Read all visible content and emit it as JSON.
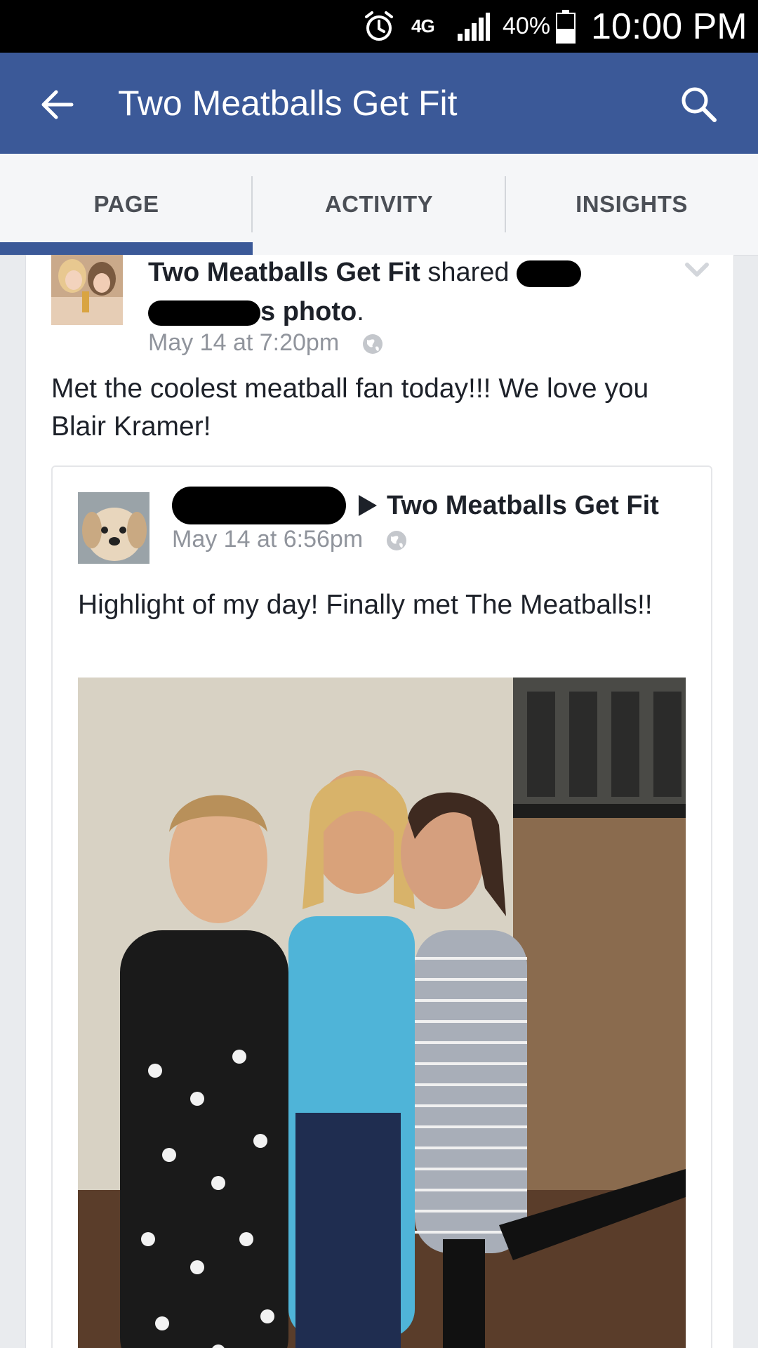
{
  "status_bar": {
    "network": "4G",
    "battery_text": "40%",
    "time": "10:00 PM",
    "icons": [
      "alarm-icon",
      "network-4g-lte-icon",
      "signal-icon",
      "battery-icon"
    ]
  },
  "app_bar": {
    "title": "Two Meatballs Get Fit",
    "icons": [
      "back-arrow-icon",
      "search-icon"
    ],
    "color": "#3b5998"
  },
  "tabs": [
    {
      "label": "PAGE",
      "selected": true
    },
    {
      "label": "ACTIVITY",
      "selected": false
    },
    {
      "label": "INSIGHTS",
      "selected": false
    }
  ],
  "post": {
    "author": "Two Meatballs Get Fit",
    "shared_word": "shared",
    "possessive_suffix": "s",
    "object": "photo",
    "period": ".",
    "timestamp": "May 14 at 7:20pm",
    "text": "Met the coolest meatball fan today!!! We love you Blair Kramer!"
  },
  "shared_post": {
    "target": "Two Meatballs Get Fit",
    "timestamp": "May 14 at 6:56pm",
    "text": "Highlight of my day!  Finally met The Meatballs!!"
  }
}
